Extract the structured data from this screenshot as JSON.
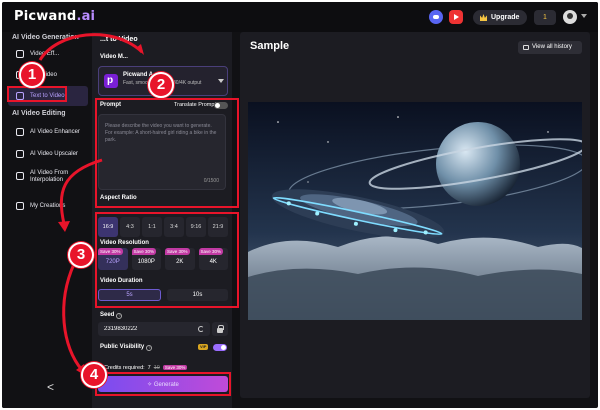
{
  "app": {
    "logo_main": "Picwand",
    "logo_ai": ".ai"
  },
  "topbar": {
    "upgrade_label": "Upgrade",
    "credits": "1"
  },
  "sidebar": {
    "section_generation": "AI Video Generation",
    "section_editing": "AI Video Editing",
    "items": [
      {
        "label": "Video Eff..."
      },
      {
        "label": "...to Video"
      },
      {
        "label": "Text to Video"
      },
      {
        "label": "AI Video Enhancer"
      },
      {
        "label": "AI Video Upscaler"
      },
      {
        "label": "AI Video From Interpolation"
      },
      {
        "label": "My Creations"
      }
    ],
    "collapse_glyph": "<"
  },
  "form": {
    "title": "...t to Video",
    "model_label": "Video M...",
    "model": {
      "name": "Picwand A...",
      "description": "Fast, smoot... ...ndr 1080/4K output"
    },
    "prompt_label": "Prompt",
    "translate_label": "Translate Prompt",
    "prompt_placeholder": "Please describe the video you want to generate. For example: A short-haired girl riding a bike in the park.",
    "char_count": "0/1500",
    "aspect_label": "Aspect Ratio",
    "aspect_ratios": [
      "16:9",
      "4:3",
      "1:1",
      "3:4",
      "9:16",
      "21:9"
    ],
    "resolution_label": "Video Resolution",
    "resolutions": [
      {
        "badge": "Save 30%",
        "label": "720P"
      },
      {
        "badge": "Save 30%",
        "label": "1080P"
      },
      {
        "badge": "Save 30%",
        "label": "2K"
      },
      {
        "badge": "Save 30%",
        "label": "4K"
      }
    ],
    "duration_label": "Video Duration",
    "durations": [
      "5s",
      "10s"
    ],
    "seed_label": "Seed",
    "seed_value": "2319830222",
    "visibility_label": "Public Visibility",
    "vip_badge": "VIP",
    "credits_label": "Credits required:",
    "credits_value": "7",
    "credits_old": "10",
    "credits_save": "Save 30%",
    "generate_label": "✧ Generate"
  },
  "sample": {
    "title": "Sample",
    "history_label": "View all history"
  },
  "annotations": {
    "step1": "1",
    "step2": "2",
    "step3": "3",
    "step4": "4",
    "color": "#e8142a"
  }
}
